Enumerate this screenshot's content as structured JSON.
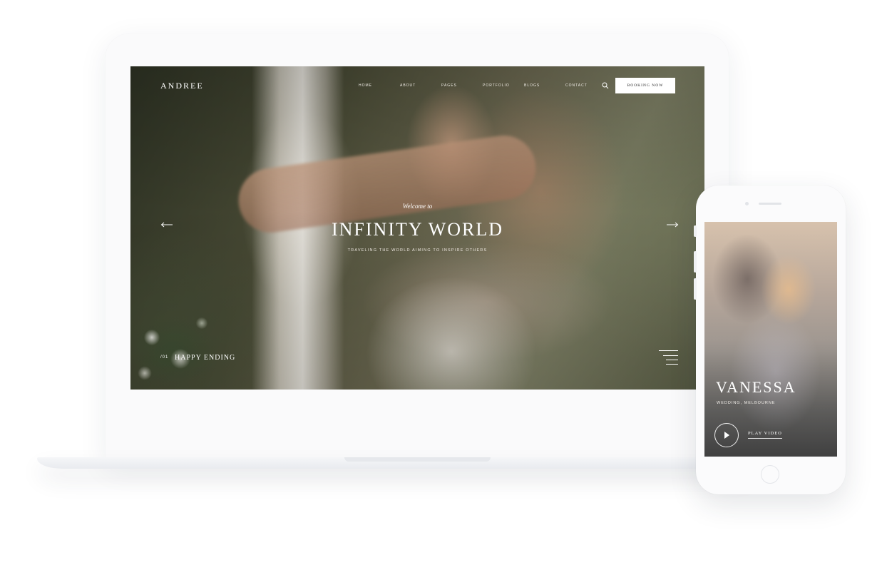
{
  "desktop": {
    "logo": "ANDREE",
    "menu": [
      "HOME",
      "ABOUT",
      "PAGES",
      "PORTFOLIO",
      "BLOGS",
      "CONTACT"
    ],
    "booking_button": "BOOKING NOW",
    "hero": {
      "welcome": "Welcome to",
      "title": "INFINITY WORLD",
      "subtitle": "TRAVELING THE WORLD AIMING TO INSPIRE OTHERS"
    },
    "slide": {
      "number": "/01",
      "title": "HAPPY ENDING"
    },
    "icons": {
      "search": "search-icon",
      "prev": "arrow-left-icon",
      "next": "arrow-right-icon",
      "menu": "hamburger-icon"
    }
  },
  "mobile": {
    "title": "VANESSA",
    "subtitle": "WEDDING, MELBOURNE",
    "play_label": "PLAY VIDEO",
    "icons": {
      "play": "play-icon"
    }
  },
  "colors": {
    "accent": "#ffffff",
    "button_text": "#1d1d1d",
    "device_frame": "#fafafb"
  }
}
